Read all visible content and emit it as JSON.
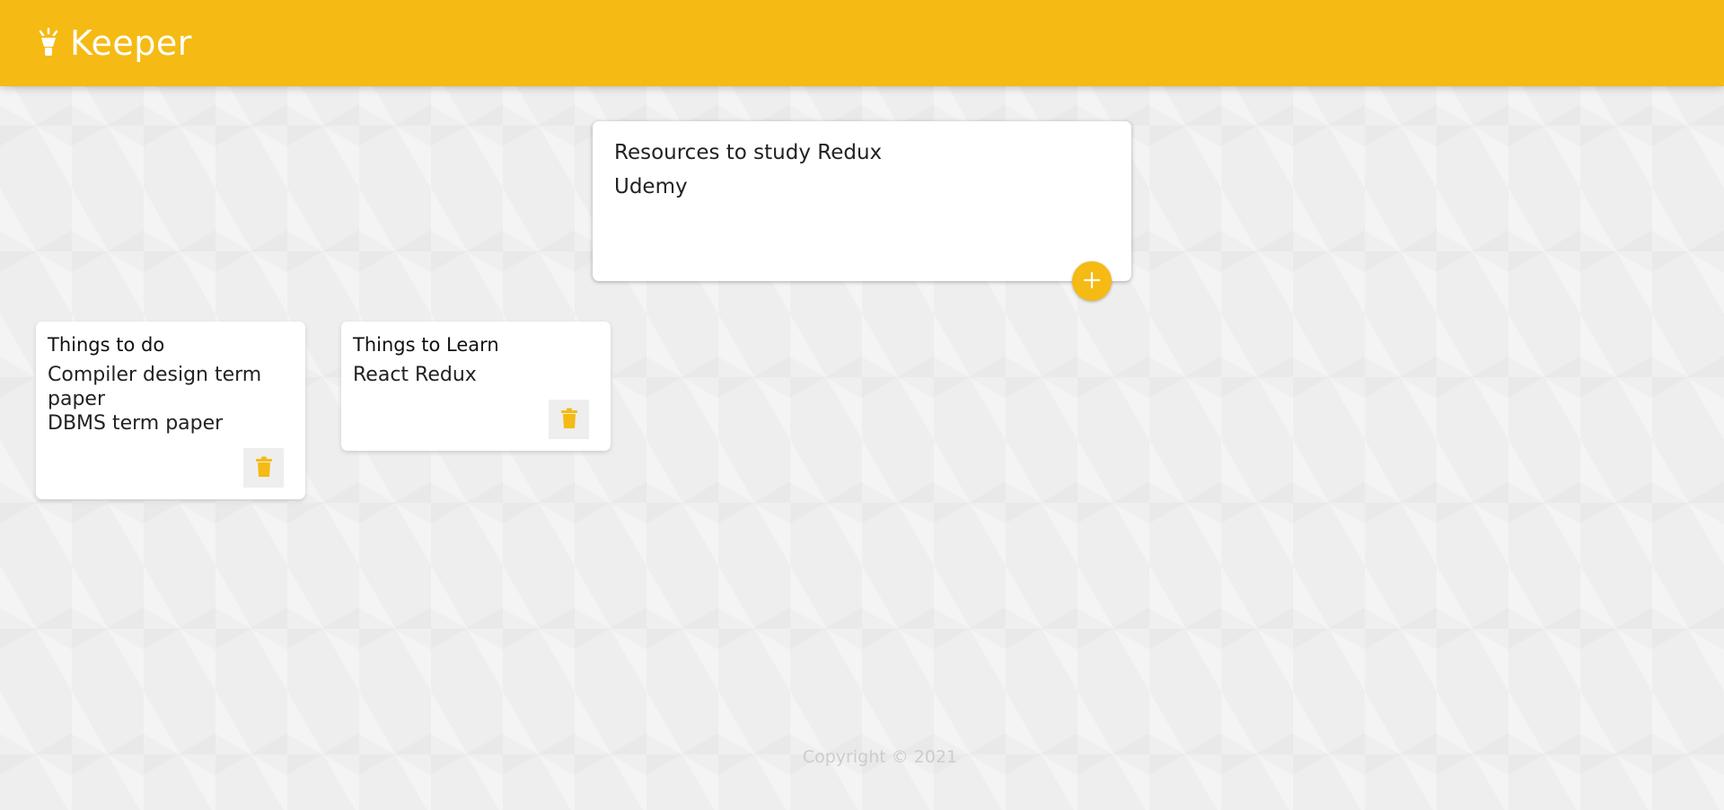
{
  "header": {
    "logo_icon": "lightbulb-icon",
    "title": "Keeper"
  },
  "create_area": {
    "title_value": "Resources to study Redux",
    "content_value": "Udemy",
    "add_icon": "plus-icon"
  },
  "notes": [
    {
      "title": "Things to do",
      "content": "Compiler design term paper\nDBMS term paper",
      "delete_icon": "trash-icon"
    },
    {
      "title": "Things to Learn",
      "content": "React Redux",
      "delete_icon": "trash-icon"
    }
  ],
  "footer": {
    "copyright": "Copyright © 2021"
  },
  "colors": {
    "accent": "#f5ba13",
    "background": "#eeeeee",
    "footer_text": "#cccccc"
  }
}
